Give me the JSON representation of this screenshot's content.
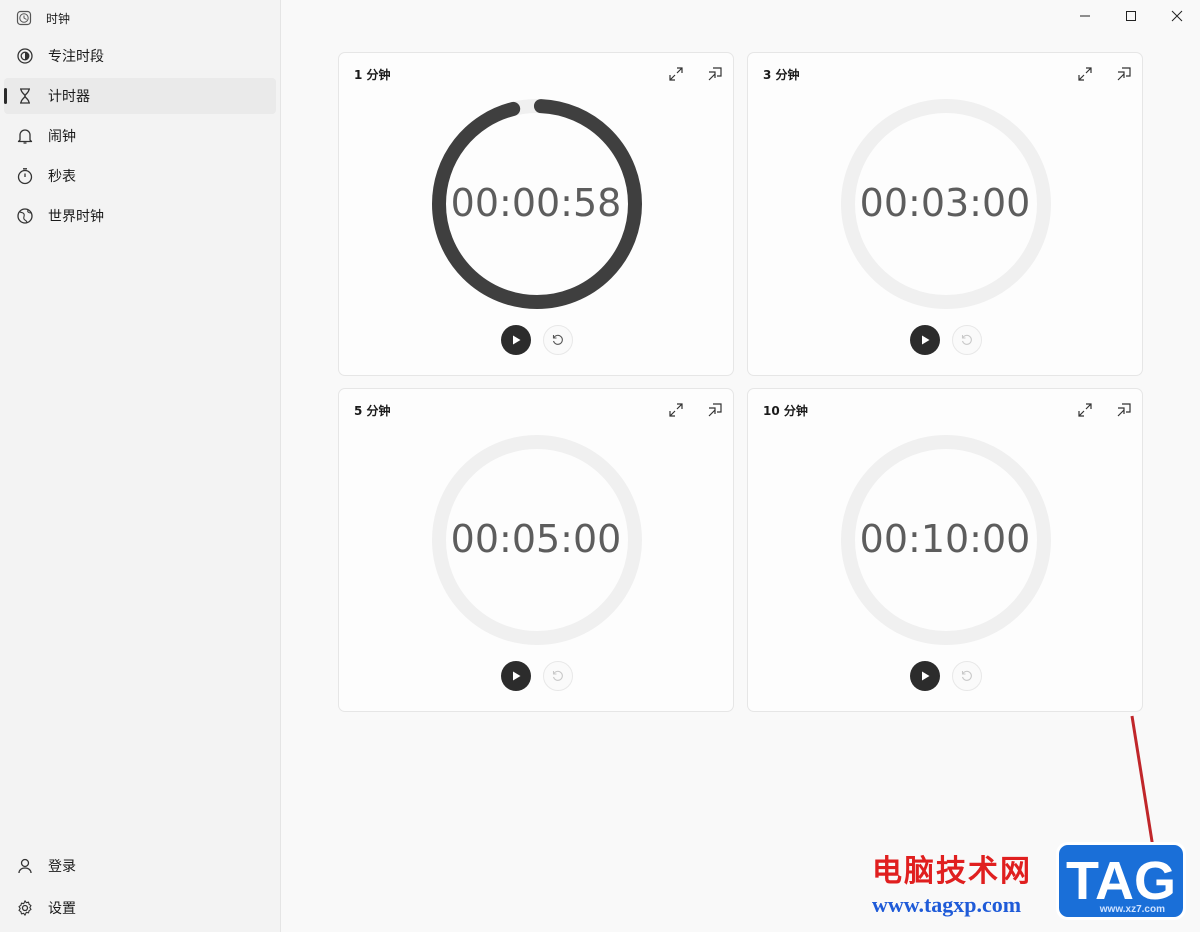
{
  "app": {
    "title": "时钟"
  },
  "sidebar": {
    "items": [
      {
        "label": "专注时段",
        "icon": "focus-icon",
        "active": false
      },
      {
        "label": "计时器",
        "icon": "hourglass-icon",
        "active": true
      },
      {
        "label": "闹钟",
        "icon": "bell-icon",
        "active": false
      },
      {
        "label": "秒表",
        "icon": "stopwatch-icon",
        "active": false
      },
      {
        "label": "世界时钟",
        "icon": "globe-icon",
        "active": false
      }
    ],
    "bottom": [
      {
        "label": "登录",
        "icon": "person-icon"
      },
      {
        "label": "设置",
        "icon": "gear-icon"
      }
    ]
  },
  "timers": [
    {
      "name": "1 分钟",
      "time": "00:00:58",
      "progress": 0.967,
      "running": true
    },
    {
      "name": "3 分钟",
      "time": "00:03:00",
      "progress": 0,
      "running": false
    },
    {
      "name": "5 分钟",
      "time": "00:05:00",
      "progress": 0,
      "running": false
    },
    {
      "name": "10 分钟",
      "time": "00:10:00",
      "progress": 0,
      "running": false
    }
  ],
  "colors": {
    "ring_active": "#3f3f3f",
    "ring_track": "#f0f0f0"
  },
  "watermark": {
    "line1": "电脑技术网",
    "line2": "www.tagxp.com",
    "badge": "TAG",
    "small": "www.xz7.com"
  }
}
